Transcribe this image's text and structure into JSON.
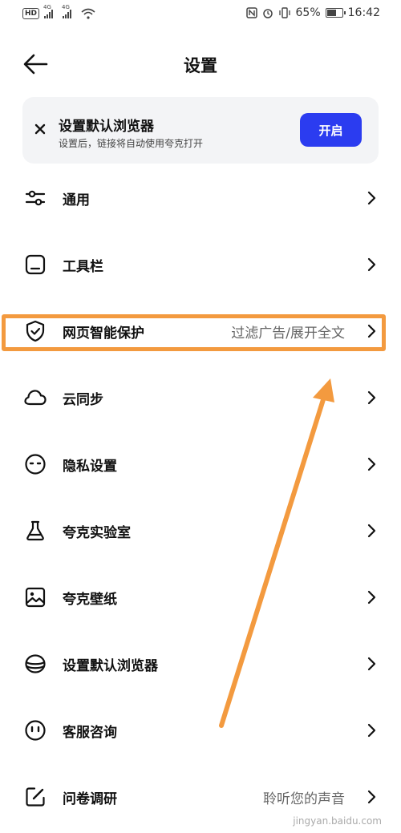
{
  "status_bar": {
    "left_badges": [
      "HD",
      "4G",
      "4G"
    ],
    "battery_percent": "65%",
    "time": "16:42"
  },
  "header": {
    "title": "设置"
  },
  "banner": {
    "title": "设置默认浏览器",
    "subtitle": "设置后，链接将自动使用夸克打开",
    "button_label": "开启"
  },
  "settings": {
    "items": [
      {
        "label": "通用",
        "value": "",
        "icon": "sliders-icon"
      },
      {
        "label": "工具栏",
        "value": "",
        "icon": "toolbar-icon"
      },
      {
        "label": "网页智能保护",
        "value": "过滤广告/展开全文",
        "icon": "shield-check-icon"
      },
      {
        "label": "云同步",
        "value": "",
        "icon": "cloud-icon"
      },
      {
        "label": "隐私设置",
        "value": "",
        "icon": "privacy-face-icon"
      },
      {
        "label": "夸克实验室",
        "value": "",
        "icon": "flask-icon"
      },
      {
        "label": "夸克壁纸",
        "value": "",
        "icon": "image-icon"
      },
      {
        "label": "设置默认浏览器",
        "value": "",
        "icon": "database-icon"
      },
      {
        "label": "客服咨询",
        "value": "",
        "icon": "smile-icon"
      },
      {
        "label": "问卷调研",
        "value": "聆听您的声音",
        "icon": "edit-icon"
      }
    ]
  },
  "watermark": "jingyan.baidu.com",
  "colors": {
    "accent_button": "#2b3cf0",
    "annotation_orange": "#f39a3f",
    "banner_bg": "#f3f4f6"
  }
}
